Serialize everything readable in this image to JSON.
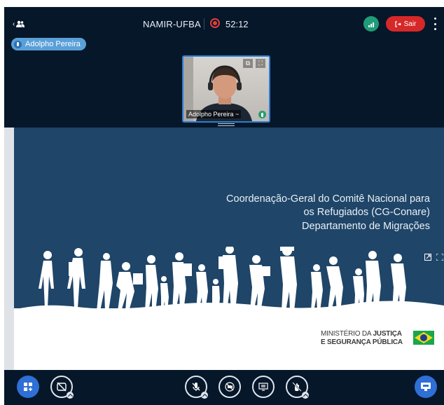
{
  "header": {
    "meeting_title": "NAMIR-UFBA",
    "recording_time": "52:12",
    "leave_label": "Sair",
    "leave_icon": "logout-icon",
    "connection_icon": "signal-icon",
    "options_icon": "more-vertical-icon",
    "users_icon": "users-icon"
  },
  "talking": {
    "name": "Adolpho Pereira"
  },
  "webcam": {
    "name": "Adolpho Pereira",
    "name_suffix": "~"
  },
  "presentation": {
    "line1": "Coordenação-Geral do Comitê Nacional para",
    "line2": "os Refugiados (CG-Conare)",
    "line3": "Departamento de Migrações",
    "ministry_line1_normal": "MINISTÉRIO DA ",
    "ministry_line1_bold": "JUSTIÇA",
    "ministry_line2": "E SEGURANÇA PÚBLICA"
  },
  "toolbar": {
    "actions_icon": "plus-grid-icon",
    "audio_icon": "headphones-off-icon",
    "mic_icon": "mic-off-icon",
    "camera_icon": "video-off-icon",
    "screenshare_icon": "screen-share-icon",
    "raise_hand_icon": "hand-off-icon",
    "presentation_icon": "presentation-icon"
  },
  "colors": {
    "background": "#06172a",
    "slide": "#1f4568",
    "leave": "#d62828",
    "accent": "#2f6fd6",
    "talking": "#5aa0d8",
    "connection": "#1f9d78"
  }
}
